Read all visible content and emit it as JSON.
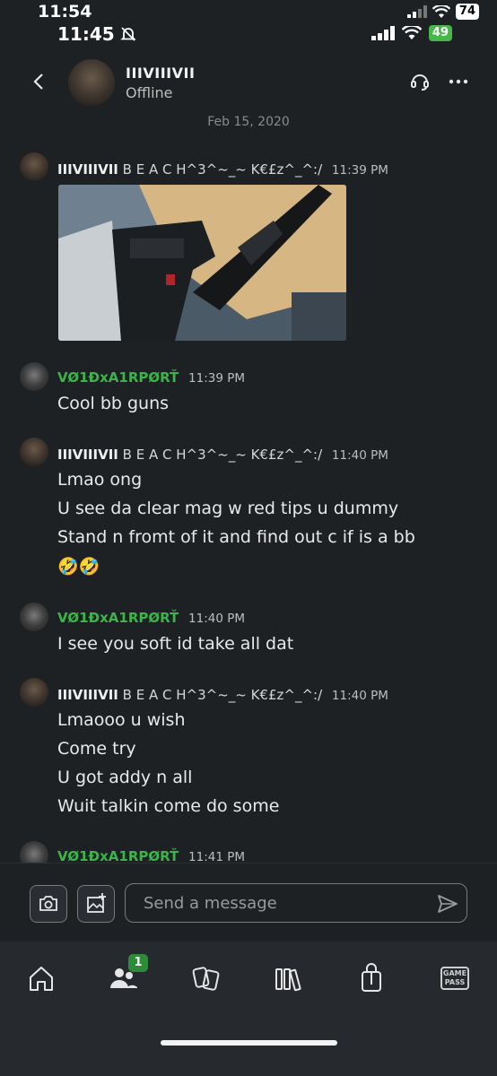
{
  "outer_status": {
    "time": "11:54",
    "battery": "74"
  },
  "inner_status": {
    "time": "11:45",
    "battery": "49"
  },
  "header": {
    "name": "IIIVIIIVII",
    "status": "Offline",
    "date_divider": "Feb 15, 2020"
  },
  "messages": [
    {
      "author": "IIIVIIIVII",
      "gamertag": "B E A C H^3^~_~ K€£z^_^:/",
      "time": "11:39 PM",
      "lines": [],
      "has_photo": true
    },
    {
      "author": "VØ1ÐxA1RPØRŤ",
      "gamertag": "",
      "time": "11:39 PM",
      "lines": [
        "Cool bb guns"
      ]
    },
    {
      "author": "IIIVIIIVII",
      "gamertag": "B E A C H^3^~_~ K€£z^_^:/",
      "time": "11:40 PM",
      "lines": [
        "Lmao ong",
        "U see da clear mag w red tips u dummy",
        "Stand n fromt of it and find out c if is a bb",
        "🤣🤣"
      ]
    },
    {
      "author": "VØ1ÐxA1RPØRŤ",
      "gamertag": "",
      "time": "11:40 PM",
      "lines": [
        "I see you soft id take all dat"
      ]
    },
    {
      "author": "IIIVIIIVII",
      "gamertag": "B E A C H^3^~_~ K€£z^_^:/",
      "time": "11:40 PM",
      "lines": [
        "Lmaooo u wish",
        "Come try",
        "U got addy n all",
        "Wuit talkin come do some"
      ]
    },
    {
      "author": "VØ1ÐxA1RPØRŤ",
      "gamertag": "",
      "time": "11:41 PM",
      "lines": []
    }
  ],
  "composer": {
    "placeholder": "Send a message"
  },
  "tabbar": {
    "items": [
      "home-icon",
      "friends-icon",
      "social-icon",
      "library-icon",
      "store-icon",
      "game-pass-icon"
    ],
    "friends_badge": "1",
    "game_pass_label_1": "GAME",
    "game_pass_label_2": "PASS"
  },
  "colors": {
    "background": "#1e2124",
    "accent_green": "#3bb54a",
    "tabbar": "#262a2e"
  }
}
